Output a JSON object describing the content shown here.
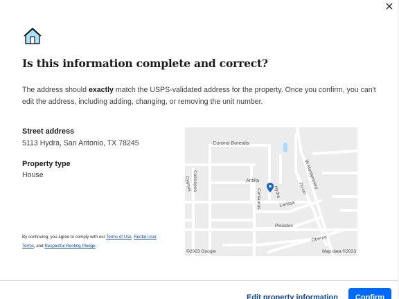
{
  "modal": {
    "title": "Is this information complete and correct?",
    "desc_before": "The address should ",
    "desc_bold": "exactly",
    "desc_after": " match the USPS-validated address for the property. Once you confirm, you can't edit the address, including adding, changing, or removing the unit number."
  },
  "fields": {
    "street_label": "Street address",
    "street_value": "5113 Hydra, San Antonio, TX 78245",
    "type_label": "Property type",
    "type_value": "House"
  },
  "legal": {
    "prefix": "By continuing, you agree to comply with our ",
    "terms_link": "Terms of Use",
    "sep1": ", ",
    "rental_terms_link": "Rental User Terms",
    "sep2": ", and ",
    "pledge_link": "Respectful Renting Pledge",
    "suffix": "."
  },
  "map": {
    "streets": [
      "Corona Borealis",
      "Cassiopea",
      "Cygnus",
      "Antilia",
      "Centaurus",
      "Hydra",
      "Javian",
      "W Montgomery",
      "Larissa",
      "Pleiades",
      "Oberon"
    ],
    "copyright_left": "©2023 Google",
    "copyright_right": "Map data ©2023",
    "pin_color": "#1a5fc7"
  },
  "footer": {
    "edit_label": "Edit property information",
    "confirm_label": "Confirm"
  },
  "icons": {
    "house": "house-icon",
    "close": "close-icon",
    "pin": "map-pin-icon"
  },
  "colors": {
    "primary": "#006aff",
    "link": "#0d4599",
    "house_icon_bg": "#a6e5ff"
  }
}
